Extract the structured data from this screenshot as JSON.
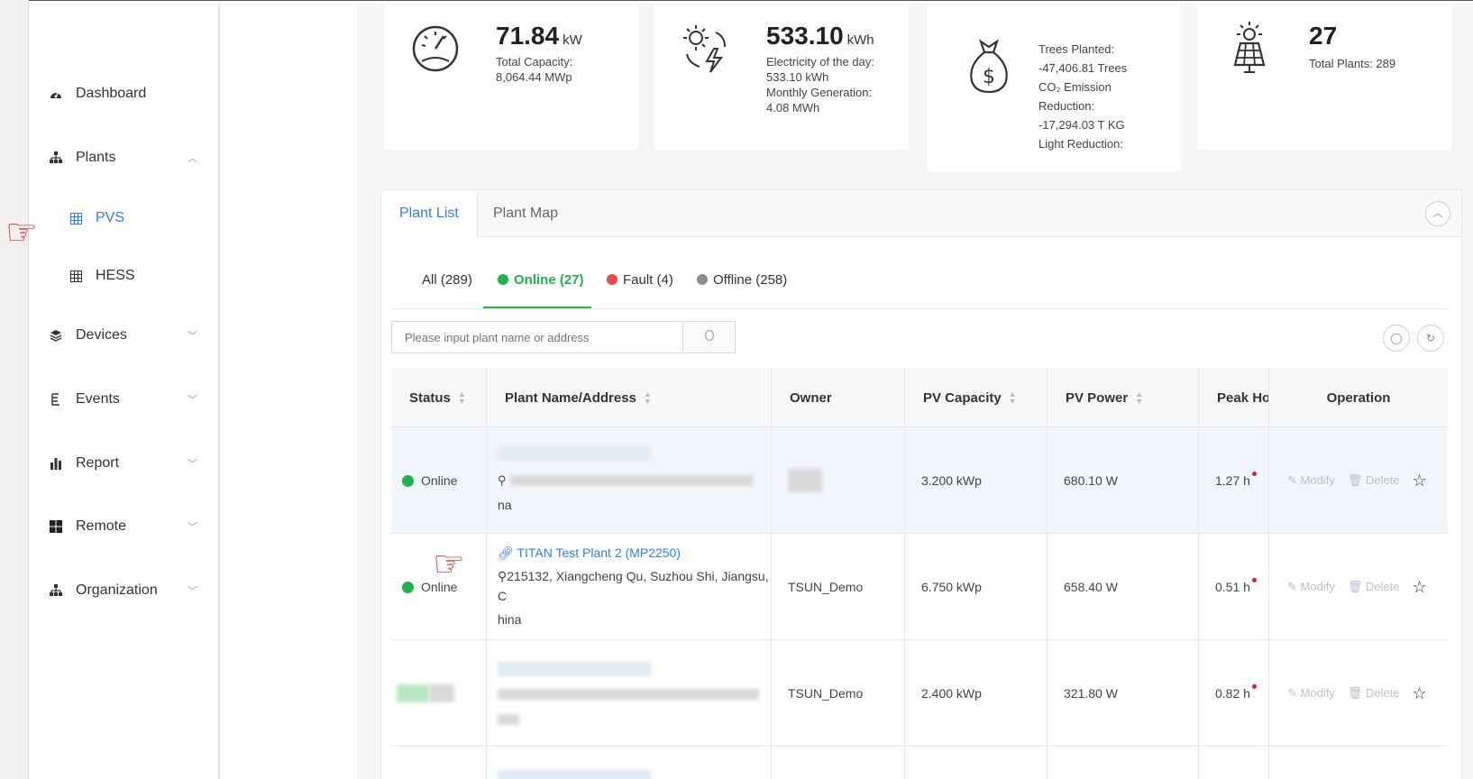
{
  "sidebar": {
    "items": [
      {
        "label": "Dashboard",
        "icon": "dashboard-icon"
      },
      {
        "label": "Plants",
        "icon": "sitemap-icon"
      },
      {
        "label": "PVS",
        "icon": "table-icon"
      },
      {
        "label": "HESS",
        "icon": "table-icon"
      },
      {
        "label": "Devices",
        "icon": "layers-icon"
      },
      {
        "label": "Events",
        "icon": "event-icon"
      },
      {
        "label": "Report",
        "icon": "bar-chart-icon"
      },
      {
        "label": "Remote",
        "icon": "grid-icon"
      },
      {
        "label": "Organization",
        "icon": "sitemap-icon"
      }
    ]
  },
  "stats": {
    "power": {
      "value": "71.84",
      "unit": "kW",
      "line1": "Total Capacity:",
      "line2": "8,064.44 MWp"
    },
    "energy": {
      "value": "533.10",
      "unit": "kWh",
      "line1": "Electricity of the day:",
      "line2": "533.10 kWh",
      "line3": "Monthly Generation:",
      "line4": "4.08 MWh"
    },
    "env": {
      "line1": "Trees Planted:",
      "line2": "-47,406.81 Trees",
      "line3": "CO₂ Emission",
      "line4": "Reduction:",
      "line5": "-17,294.03 T KG",
      "line6": "Light Reduction:"
    },
    "plants": {
      "value": "27",
      "line1": "Total Plants: 289"
    }
  },
  "panel": {
    "tabs": [
      "Plant List",
      "Plant Map"
    ],
    "filters": {
      "all": "All (289)",
      "online": "Online (27)",
      "fault": "Fault (4)",
      "offline": "Offline (258)"
    },
    "search_placeholder": "Please input plant name or address"
  },
  "table": {
    "headers": {
      "status": "Status",
      "name": "Plant Name/Address",
      "owner": "Owner",
      "capacity": "PV Capacity",
      "power": "PV Power",
      "peak": "Peak Hour",
      "operation": "Operation"
    },
    "rows": [
      {
        "status": "Online",
        "name": "",
        "address_tail": "na",
        "owner": "",
        "capacity": "3.200 kWp",
        "power": "680.10 W",
        "peak": "1.27 h"
      },
      {
        "status": "Online",
        "name": "TITAN Test Plant 2 (MP2250)",
        "address": "215132, Xiangcheng Qu, Suzhou Shi, Jiangsu, C",
        "address_tail": "hina",
        "owner": "TSUN_Demo",
        "capacity": "6.750 kWp",
        "power": "658.40 W",
        "peak": "0.51 h"
      },
      {
        "status": "",
        "name": "",
        "address_tail": "",
        "owner": "TSUN_Demo",
        "capacity": "2.400 kWp",
        "power": "321.80 W",
        "peak": "0.82 h"
      }
    ],
    "op_modify": "Modify",
    "op_delete": "Delete"
  },
  "colors": {
    "accent": "#2f7fe5",
    "online": "#22b14c",
    "fault": "#f0484a",
    "offline": "#8c8c8c",
    "pointer": "#e02020"
  }
}
